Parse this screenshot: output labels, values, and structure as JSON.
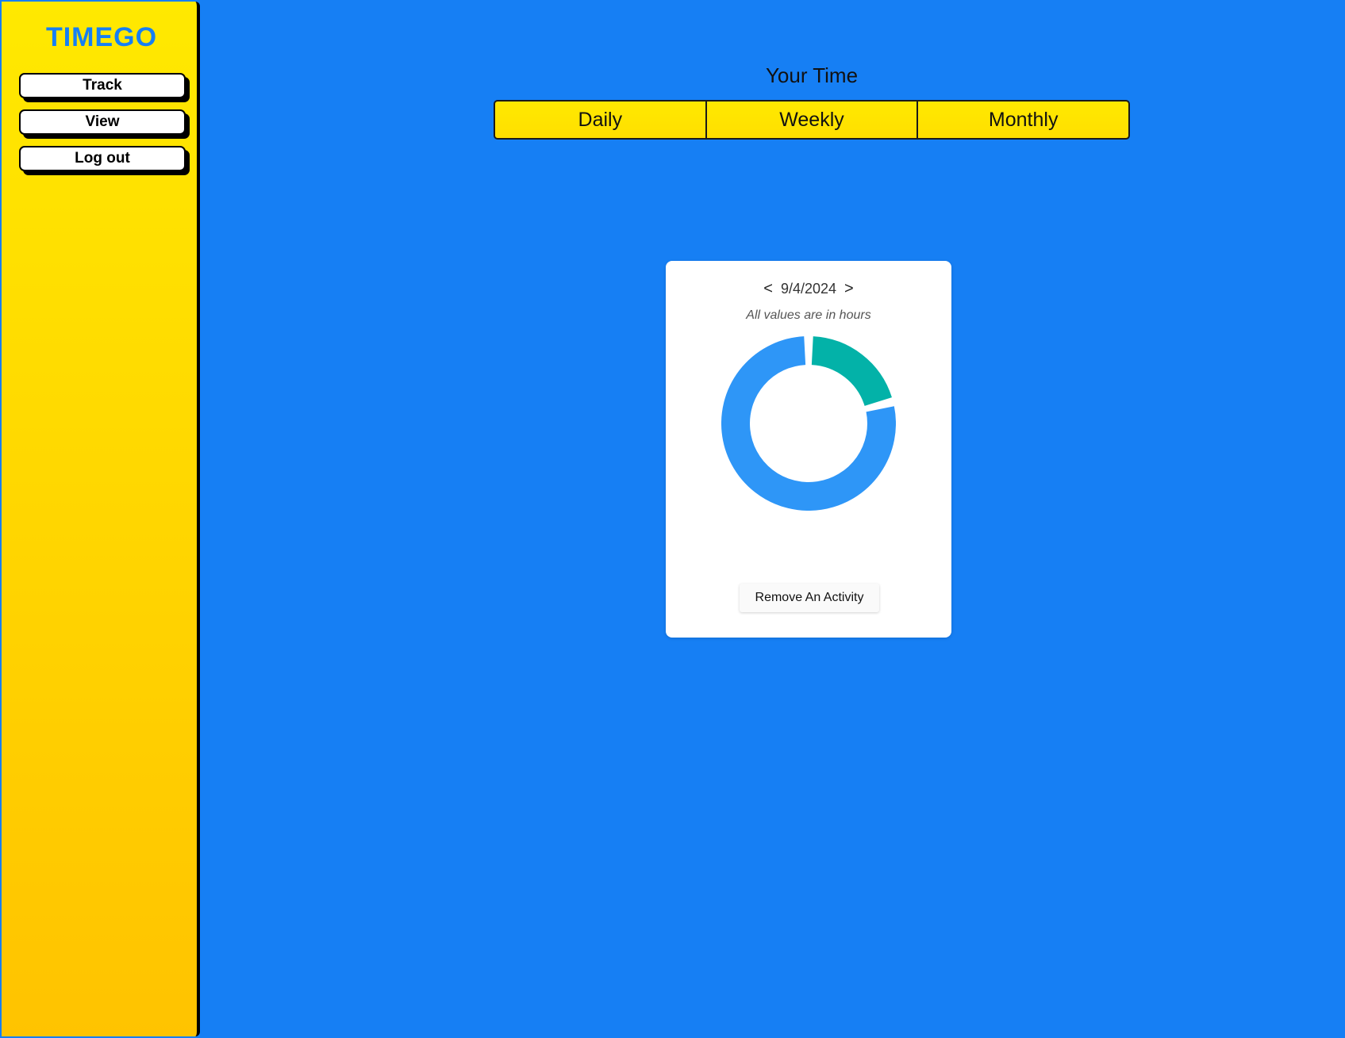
{
  "app": {
    "logo_text": "TIMEGO",
    "brand_color": "#167ff4",
    "sidebar_color": "#ffe100"
  },
  "sidebar": {
    "items": [
      {
        "label": "Track"
      },
      {
        "label": "View"
      },
      {
        "label": "Log out"
      }
    ]
  },
  "main": {
    "title": "Your Time",
    "tabs": [
      {
        "label": "Daily"
      },
      {
        "label": "Weekly"
      },
      {
        "label": "Monthly"
      }
    ]
  },
  "card": {
    "prev_label": "<",
    "next_label": ">",
    "date": "9/4/2024",
    "note": "All values are in hours",
    "remove_button_label": "Remove An Activity"
  },
  "chart_data": {
    "type": "pie",
    "variant": "donut",
    "title": "",
    "slices": [
      {
        "value": 0.21,
        "color": "#03b2a8"
      },
      {
        "value": 0.79,
        "color": "#2e96f7"
      }
    ]
  }
}
